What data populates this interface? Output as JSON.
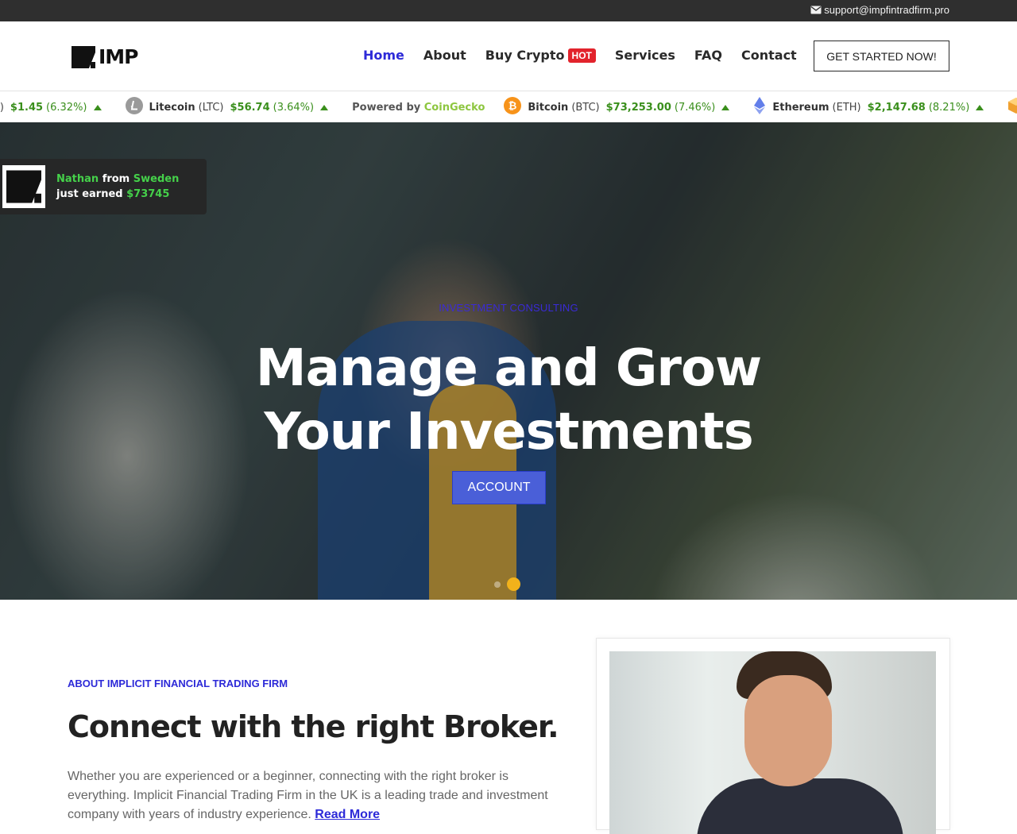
{
  "topbar": {
    "email": "support@impfintradfirm.pro",
    "icon": "envelope-icon"
  },
  "header": {
    "logo_text": "IMP",
    "nav": [
      {
        "label": "Home",
        "active": true
      },
      {
        "label": "About"
      },
      {
        "label": "Buy Crypto",
        "badge": "HOT"
      },
      {
        "label": "Services"
      },
      {
        "label": "FAQ"
      },
      {
        "label": "Contact"
      }
    ],
    "cta_label": "GET STARTED NOW!"
  },
  "ticker": {
    "first": {
      "sym_tail": "P)",
      "price": "$1.45",
      "change": "(6.32%)"
    },
    "items": [
      {
        "name": "Litecoin",
        "symbol": "(LTC)",
        "price": "$56.74",
        "change": "(3.64%)"
      },
      {
        "name": "Bitcoin",
        "symbol": "(BTC)",
        "price": "$73,253.00",
        "change": "(7.46%)"
      },
      {
        "name": "Ethereum",
        "symbol": "(ETH)",
        "price": "$2,147.68",
        "change": "(8.21%)"
      }
    ],
    "powered_prefix": "Powered by",
    "powered_brand": "CoinGecko"
  },
  "toast": {
    "name": "Nathan",
    "from_word": "from",
    "country": "Sweden",
    "earned_text": "just earned",
    "amount": "$73745"
  },
  "hero": {
    "kicker": "INVESTMENT CONSULTING",
    "title_line1": "Manage and Grow",
    "title_line2": "Your Investments",
    "button_label": "ACCOUNT",
    "slides_total": 2,
    "active_slide": 2
  },
  "about": {
    "kicker": "ABOUT IMPLICIT FINANCIAL TRADING FIRM",
    "heading": "Connect with the right Broker.",
    "paragraph": "Whether you are experienced or a beginner, connecting with the right broker is everything. Implicit Financial Trading Firm in the UK is a leading trade and investment company with years of industry experience.",
    "read_more": "Read More"
  },
  "colors": {
    "accent": "#2d2ad8",
    "price_green": "#3a8f1c",
    "hot_red": "#e2232c",
    "toast_green": "#45d14a",
    "slider_active": "#f2b21b"
  }
}
